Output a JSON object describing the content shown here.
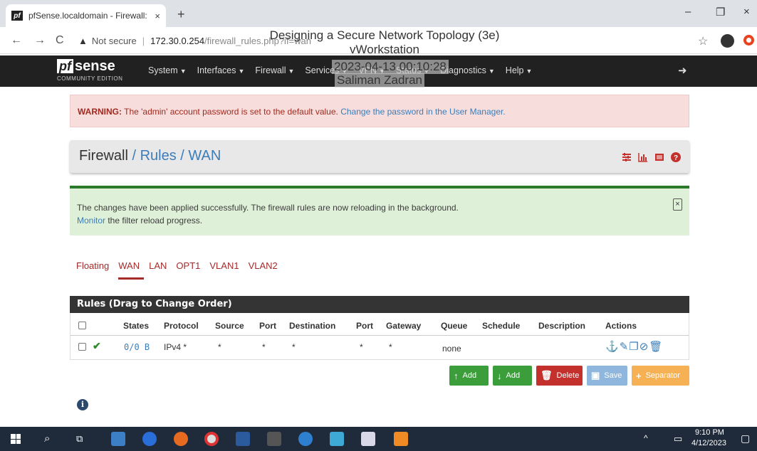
{
  "browser": {
    "tab_title": "pfSense.localdomain - Firewall: R",
    "tab_close": "×",
    "new_tab": "+",
    "security_label": "Not secure",
    "url_host": "172.30.0.254",
    "url_path": "/firewall_rules.php?if=wan"
  },
  "watermark": {
    "line1": "Designing a Secure Network Topology (3e)",
    "line2": "vWorkstation",
    "line3": "2023-04-13 00:10:28",
    "line4": "Saliman Zadran"
  },
  "navbar": {
    "logo_pf": "pf",
    "logo_sense": "sense",
    "logo_edition": "COMMUNITY EDITION",
    "menu": [
      "System",
      "Interfaces",
      "Firewall",
      "Services",
      "VPN",
      "Status",
      "Diagnostics",
      "Help"
    ]
  },
  "warning": {
    "label": "WARNING:",
    "text": " The 'admin' account password is set to the default value. ",
    "link": "Change the password in the User Manager."
  },
  "breadcrumb": {
    "root": "Firewall",
    "sep1": " / ",
    "mid": "Rules",
    "sep2": " / ",
    "current": "WAN"
  },
  "success": {
    "text": "The changes have been applied successfully. The firewall rules are now reloading in the background.",
    "link": "Monitor",
    "text2": " the filter reload progress."
  },
  "tabs": [
    "Floating",
    "WAN",
    "LAN",
    "OPT1",
    "VLAN1",
    "VLAN2"
  ],
  "rules": {
    "title": "Rules (Drag to Change Order)",
    "headers": [
      "States",
      "Protocol",
      "Source",
      "Port",
      "Destination",
      "Port",
      "Gateway",
      "Queue",
      "Schedule",
      "Description",
      "Actions"
    ],
    "row": {
      "status": "✔",
      "states": "0/0 B",
      "protocol": "IPv4 *",
      "source": "*",
      "port": "*",
      "destination": "*",
      "dport": "*",
      "gateway": "*",
      "queue": "none",
      "schedule": "",
      "description": ""
    }
  },
  "buttons": {
    "add_top": "Add",
    "add_bottom": "Add",
    "delete": "Delete",
    "save": "Save",
    "separator": "Separator"
  },
  "taskbar": {
    "time": "9:10 PM",
    "date": "4/12/2023"
  },
  "colors": {
    "navbar": "#212121",
    "accent_red": "#a52a2a",
    "link_blue": "#3b7dba",
    "success_green": "#3b9e3b"
  }
}
